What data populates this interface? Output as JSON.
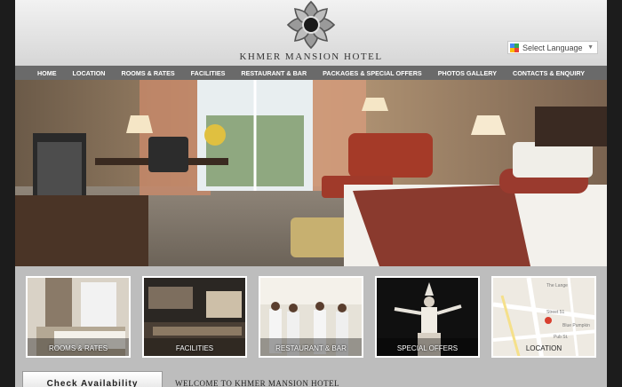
{
  "header": {
    "brand": "KHMER MANSION HOTEL",
    "language_select": "Select Language"
  },
  "nav": {
    "items": [
      "HOME",
      "LOCATION",
      "ROOMS & RATES",
      "FACILITIES",
      "RESTAURANT & BAR",
      "PACKAGES & SPECIAL OFFERS",
      "PHOTOS GALLERY",
      "CONTACTS & ENQUIRY"
    ]
  },
  "hero": {
    "icon": "hotel-room-photo"
  },
  "thumbs": {
    "rooms": "ROOMS & RATES",
    "facilities": "FACILITIES",
    "restaurant": "RESTAURANT & BAR",
    "offers": "SPECIAL OFFERS",
    "location": "LOCATION",
    "map_labels": [
      "The Lange",
      "Street 51",
      "Blue Pumpkin",
      "Pub St."
    ]
  },
  "footer": {
    "check_availability": "Check Availability",
    "welcome": "WELCOME TO KHMER MANSION HOTEL"
  },
  "colors": {
    "nav_bg": "#6a6a6a",
    "header_bg": "#e8e8e8",
    "page_bg": "#bdbdbd",
    "outer_bg": "#1c1c1c"
  }
}
